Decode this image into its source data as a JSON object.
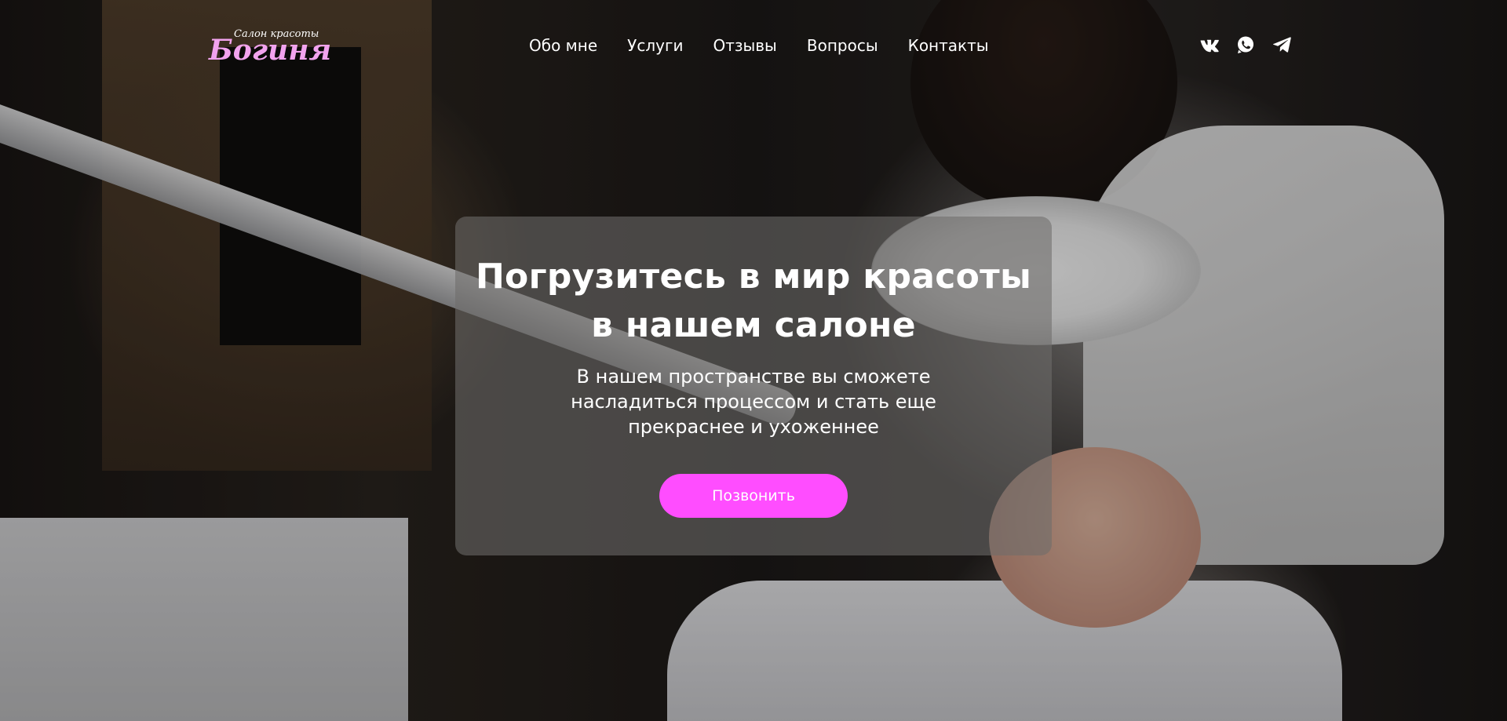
{
  "header": {
    "logo": {
      "small_text": "Салон красоты",
      "big_text": "Богиня",
      "color": "#f2a3ee"
    },
    "nav": [
      {
        "label": "Обо мне"
      },
      {
        "label": "Услуги"
      },
      {
        "label": "Отзывы"
      },
      {
        "label": "Вопросы"
      },
      {
        "label": "Контакты"
      }
    ],
    "socials": [
      {
        "icon": "vk-icon"
      },
      {
        "icon": "whatsapp-icon"
      },
      {
        "icon": "telegram-icon"
      }
    ]
  },
  "hero": {
    "background_image": "beauty-salon-facial-treatment-photo",
    "title": "Погрузитесь в мир красоты в нашем салоне",
    "subtitle": "В нашем пространстве вы сможете насладиться процессом и стать еще прекраснее и ухоженнее",
    "cta_label": "Позвонить",
    "cta_color": "#ff4dff"
  }
}
